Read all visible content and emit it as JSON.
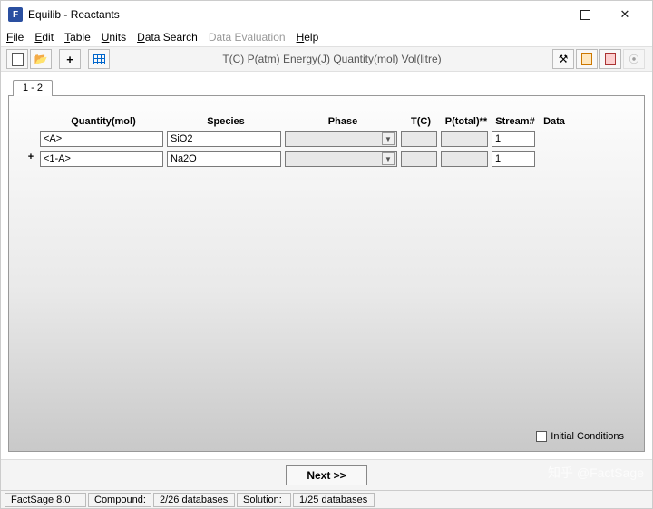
{
  "window": {
    "title": "Equilib - Reactants"
  },
  "menu": {
    "file": "File",
    "edit": "Edit",
    "table": "Table",
    "units": "Units",
    "datasearch": "Data Search",
    "dataeval": "Data Evaluation",
    "help": "Help"
  },
  "toolbar": {
    "units_text": "T(C)  P(atm)  Energy(J)  Quantity(mol)  Vol(litre)"
  },
  "tab": {
    "label": "1 - 2"
  },
  "headers": {
    "quantity": "Quantity(mol)",
    "species": "Species",
    "phase": "Phase",
    "tc": "T(C)",
    "ptotal": "P(total)**",
    "stream": "Stream#",
    "data": "Data"
  },
  "rows": [
    {
      "plus": "",
      "quantity": "<A>",
      "species": "SiO2",
      "phase": "",
      "tc": "",
      "p": "",
      "stream": "1"
    },
    {
      "plus": "+",
      "quantity": "<1-A>",
      "species": "Na2O",
      "phase": "",
      "tc": "",
      "p": "",
      "stream": "1"
    }
  ],
  "initial_conditions": {
    "label": "Initial Conditions",
    "checked": false
  },
  "next_button": "Next >>",
  "status": {
    "app": "FactSage 8.0",
    "compound_label": "Compound:",
    "compound_value": "2/26 databases",
    "solution_label": "Solution:",
    "solution_value": "1/25 databases"
  },
  "watermark": "知乎  @FactSage"
}
